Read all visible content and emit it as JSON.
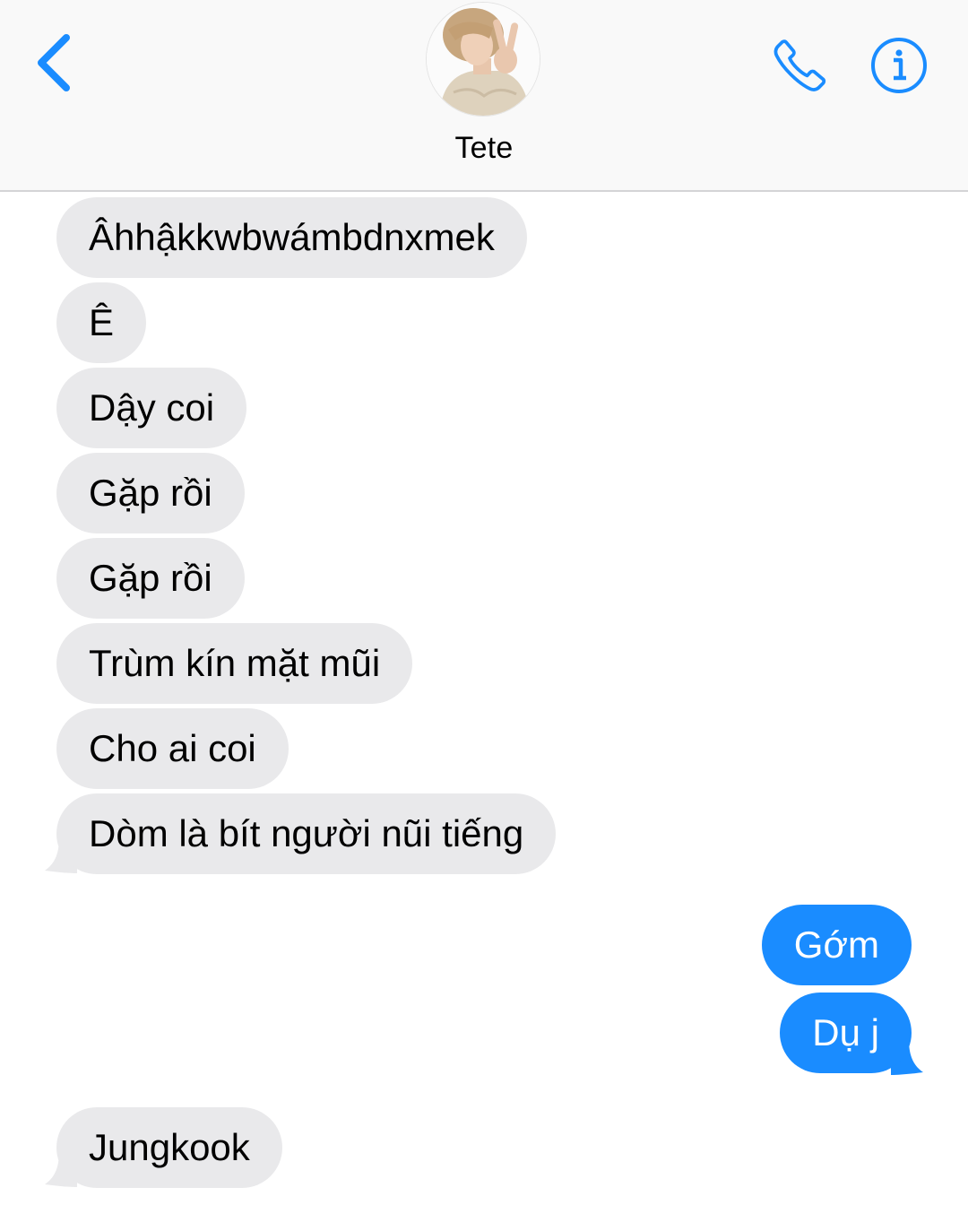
{
  "header": {
    "contact_name": "Tete"
  },
  "colors": {
    "accent": "#1a8cff",
    "incoming_bubble": "#e9e9eb",
    "outgoing_bubble": "#1a8cff",
    "header_bg": "#f9f9f9"
  },
  "icons": {
    "back": "chevron-left-icon",
    "phone": "phone-icon",
    "info": "info-icon"
  },
  "messages": [
    {
      "direction": "incoming",
      "text": "Âhhậkkwbwámbdnxmek"
    },
    {
      "direction": "incoming",
      "text": "Ê"
    },
    {
      "direction": "incoming",
      "text": "Dậy coi"
    },
    {
      "direction": "incoming",
      "text": "Gặp rồi"
    },
    {
      "direction": "incoming",
      "text": "Gặp rồi"
    },
    {
      "direction": "incoming",
      "text": "Trùm kín mặt mũi"
    },
    {
      "direction": "incoming",
      "text": "Cho ai coi"
    },
    {
      "direction": "incoming",
      "text": "Dòm là bít người nũi tiếng"
    },
    {
      "direction": "outgoing",
      "text": "Gớm"
    },
    {
      "direction": "outgoing",
      "text": "Dụ j"
    },
    {
      "direction": "incoming",
      "text": "Jungkook"
    }
  ]
}
